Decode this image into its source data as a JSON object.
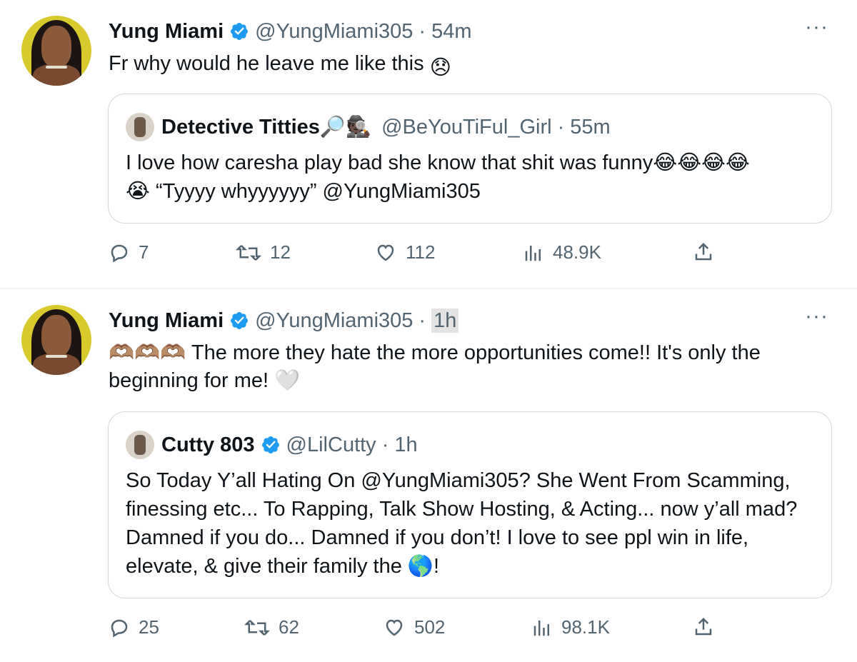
{
  "tweets": [
    {
      "author_name": "Yung Miami",
      "handle": "@YungMiami305",
      "separator": "·",
      "time": "54m",
      "more": "···",
      "text": "Fr why would he leave me like this",
      "text_emoji": "😞",
      "quote": {
        "author_name": "Detective Titties",
        "name_emojis": "🔎🕵🏿",
        "handle": "@BeYouTiFul_Girl",
        "separator": "·",
        "time": "55m",
        "text_part1": "I love how caresha play bad she know that shit was funny",
        "text_emojis1": "😂😂😂😂",
        "text_emojis2": "😭",
        "text_part2": " “Tyyyy whyyyyyy” @YungMiami305"
      },
      "stats": {
        "replies": "7",
        "retweets": "12",
        "likes": "112",
        "views": "48.9K"
      }
    },
    {
      "author_name": "Yung Miami",
      "handle": "@YungMiami305",
      "separator": "·",
      "time": "1h",
      "more": "···",
      "text_emojis_lead": "🫶🏽🫶🏽🫶🏽",
      "text": " The more they hate the more opportunities come!! It's only the beginning for me! ",
      "text_emoji_trail": "🤍",
      "quote": {
        "author_name": "Cutty 803",
        "handle": "@LilCutty",
        "separator": "·",
        "time": "1h",
        "text": "So Today Y’all Hating On @YungMiami305? She Went From Scamming, finessing etc... To Rapping, Talk Show Hosting, & Acting... now y’all mad? Damned if you do... Damned if you don’t! I love to see ppl win in life, elevate, & give their family the ",
        "text_emoji": "🌎",
        "text_end": "!"
      },
      "stats": {
        "replies": "25",
        "retweets": "62",
        "likes": "502",
        "views": "98.1K"
      }
    }
  ],
  "colors": {
    "verified": "#1d9bf0",
    "muted": "#536471",
    "border": "#cfd9de"
  }
}
